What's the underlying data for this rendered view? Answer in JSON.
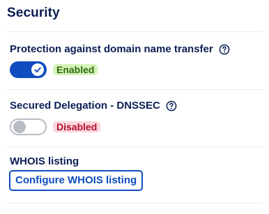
{
  "section": {
    "title": "Security"
  },
  "transfer_protection": {
    "label": "Protection against domain name transfer",
    "help_icon": "help-circle-icon",
    "toggle_state": "on",
    "status": "Enabled",
    "status_color": "#2f6b0b",
    "status_bg": "#d4f3b9"
  },
  "dnssec": {
    "label": "Secured Delegation - DNSSEC",
    "help_icon": "help-circle-icon",
    "toggle_state": "off",
    "status": "Disabled",
    "status_color": "#b2102d",
    "status_bg": "#fbd6dd"
  },
  "whois": {
    "label": "WHOIS listing",
    "button_label": "Configure WHOIS listing"
  },
  "colors": {
    "heading": "#0b1e55",
    "accent": "#0f4cc0",
    "toggle_off": "#b9bcc4",
    "divider": "#e7eaf0"
  }
}
